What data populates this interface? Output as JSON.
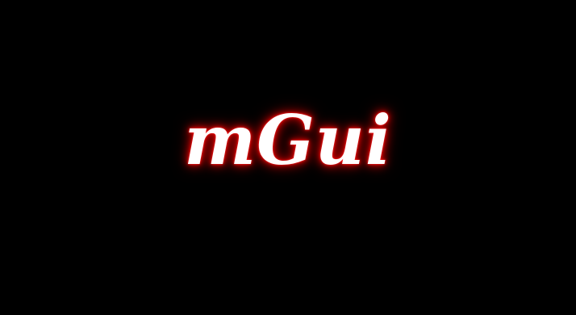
{
  "splash": {
    "logo_text": "mGui",
    "background_color": "#000000",
    "text_color": "#ffffff",
    "glow_color": "#c00000"
  }
}
